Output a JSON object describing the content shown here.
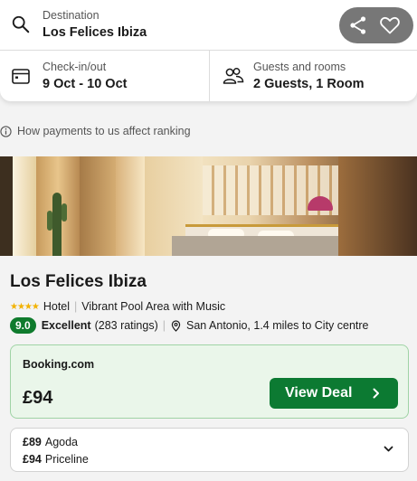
{
  "search": {
    "destination_label": "Destination",
    "destination_value": "Los Felices Ibiza",
    "dates_label": "Check-in/out",
    "dates_value": "9 Oct - 10 Oct",
    "guests_label": "Guests and rooms",
    "guests_value": "2 Guests, 1 Room"
  },
  "payments_note": "How payments to us affect ranking",
  "hotel": {
    "name": "Los Felices Ibiza",
    "star_rating": 4,
    "stars_text": "★★★★",
    "type": "Hotel",
    "highlight": "Vibrant Pool Area with Music",
    "score": "9.0",
    "score_word": "Excellent",
    "ratings_count": "(283 ratings)",
    "location": "San Antonio, 1.4 miles to City centre"
  },
  "top_deal": {
    "provider": "Booking.com",
    "price": "£94",
    "button_label": "View Deal"
  },
  "other_deals": [
    {
      "price": "£89",
      "provider": "Agoda"
    },
    {
      "price": "£94",
      "provider": "Priceline"
    }
  ],
  "icons": {
    "destination": "search-icon",
    "dates": "calendar-icon",
    "guests": "people-icon",
    "info": "info-icon",
    "share": "share-icon",
    "favorite": "heart-icon",
    "location": "map-pin-icon",
    "view_deal": "chevron-right-icon",
    "expand": "chevron-down-icon"
  },
  "colors": {
    "score_badge": "#0f7b2d",
    "view_deal_button": "#0c7a32",
    "deal_card_bg": "#eaf6ea",
    "stars": "#f2b200"
  }
}
